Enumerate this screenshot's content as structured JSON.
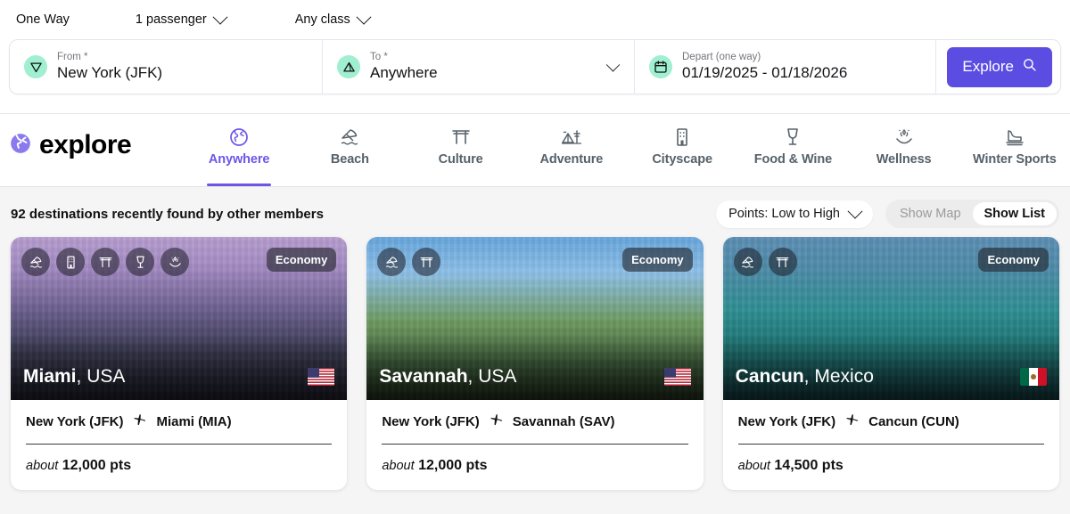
{
  "search": {
    "options": [
      {
        "label": "One Way",
        "has_chevron": false,
        "name": "trip-type"
      },
      {
        "label": "1 passenger",
        "has_chevron": true,
        "name": "passengers"
      },
      {
        "label": "Any class",
        "has_chevron": true,
        "name": "cabin-class"
      }
    ],
    "from": {
      "label": "From *",
      "value": "New York (JFK)",
      "icon": "send-origin-icon"
    },
    "to": {
      "label": "To *",
      "value": "Anywhere",
      "icon": "destination-icon"
    },
    "depart": {
      "label": "Depart (one way)",
      "value": "01/19/2025 - 01/18/2026",
      "icon": "calendar-icon"
    },
    "explore_button": {
      "label": "Explore",
      "icon": "search-icon"
    }
  },
  "brand": {
    "word": "explore",
    "icon": "globe-icon",
    "color": "#6c56e8"
  },
  "categories": [
    {
      "label": "Anywhere",
      "icon": "globe-icon",
      "active": true
    },
    {
      "label": "Beach",
      "icon": "beach-umbrella-icon",
      "active": false
    },
    {
      "label": "Culture",
      "icon": "torii-gate-icon",
      "active": false
    },
    {
      "label": "Adventure",
      "icon": "mountain-tent-icon",
      "active": false
    },
    {
      "label": "Cityscape",
      "icon": "building-icon",
      "active": false
    },
    {
      "label": "Food & Wine",
      "icon": "wine-glass-icon",
      "active": false
    },
    {
      "label": "Wellness",
      "icon": "spa-lotus-hand-icon",
      "active": false
    },
    {
      "label": "Winter Sports",
      "icon": "ice-skate-icon",
      "active": false
    }
  ],
  "results": {
    "count_text": "92 destinations recently found by other members",
    "sort": {
      "label": "Points: Low to High"
    },
    "view_toggle": {
      "map_label": "Show Map",
      "list_label": "Show List",
      "active": "Show List"
    }
  },
  "cards": [
    {
      "city": "Miami",
      "country": "USA",
      "flag": "us-flag",
      "cabin": "Economy",
      "badges": [
        "beach-umbrella-icon",
        "building-icon",
        "torii-gate-icon",
        "wine-glass-icon",
        "spa-lotus-hand-icon"
      ],
      "origin": "New York (JFK)",
      "destination": "Miami (MIA)",
      "points_prefix": "about",
      "points": "12,000 pts"
    },
    {
      "city": "Savannah",
      "country": "USA",
      "flag": "us-flag",
      "cabin": "Economy",
      "badges": [
        "beach-umbrella-icon",
        "torii-gate-icon"
      ],
      "origin": "New York (JFK)",
      "destination": "Savannah (SAV)",
      "points_prefix": "about",
      "points": "12,000 pts"
    },
    {
      "city": "Cancun",
      "country": "Mexico",
      "flag": "mx-flag",
      "cabin": "Economy",
      "badges": [
        "beach-umbrella-icon",
        "torii-gate-icon"
      ],
      "origin": "New York (JFK)",
      "destination": "Cancun (CUN)",
      "points_prefix": "about",
      "points": "14,500 pts"
    }
  ]
}
